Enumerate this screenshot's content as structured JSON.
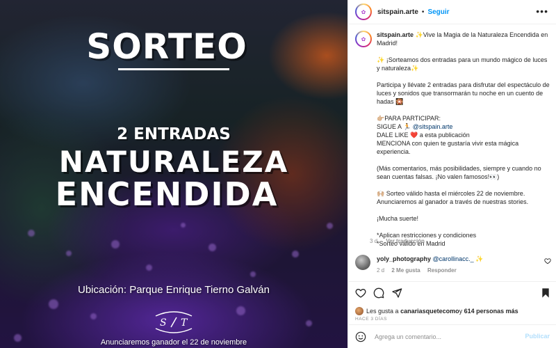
{
  "image": {
    "title": "SORTEO",
    "subtitle": "2 ENTRADAS",
    "headline_line1": "NATURALEZA",
    "headline_line2": "ENCENDIDA",
    "location": "Ubicación: Parque Enrique Tierno Galván",
    "logo_text": "S / T",
    "footer": "Anunciaremos ganador el 22 de noviembre"
  },
  "header": {
    "username": "sitspain.arte",
    "dot": "•",
    "follow_label": "Seguir",
    "more_icon": "more-horizontal-icon"
  },
  "caption": {
    "username": "sitspain.arte",
    "text": "✨Vive la Magia de la Naturaleza Encendida en Madrid!\n\n✨ ¡Sorteamos dos entradas para un mundo mágico de luces y naturaleza✨\n\nParticipa y llévate 2 entradas para disfrutar del espectáculo de luces y sonidos que transormarán tu noche en un cuento de hadas 🎇\n\n👉🏼PARA PARTICIPAR:\nSIGUE A 🏃 ",
    "mention": "@sitspain.arte",
    "text_after": "\nDALE LIKE ❤️ a esta publicación\nMENCIONA con quien te gustaría vivir esta mágica experiencia.\n\n(Más comentarios, más posibilidades, siempre y cuando no sean cuentas falsas. ¡No valen famosos!👀)\n\n🙌🏼 Sorteo válido hasta el miércoles 22 de noviembre. Anunciaremos al ganador a través de nuestras stories.\n\n¡Mucha suerte!\n\n*Aplican restricciones y condiciones\n*Sorteo válido en Madrid",
    "time": "3 d",
    "translate_label": "Ver traducción"
  },
  "comment": {
    "username": "yoly_photography",
    "mention": "@carollinacc._",
    "emoji": "✨",
    "time": "2 d",
    "likes_label": "2 Me gusta",
    "reply_label": "Responder"
  },
  "actions": {
    "likes_prefix": "Les gusta a ",
    "likes_user": "canariasquetecomo",
    "likes_middle": " y ",
    "likes_count": "614 personas más",
    "time_ago": "HACE 3 DÍAS"
  },
  "add_comment": {
    "placeholder": "Agrega un comentario...",
    "submit_label": "Publicar",
    "submit_color": "#b2dffc"
  },
  "colors": {
    "link_blue": "#0095f6",
    "mention_blue": "#00376b",
    "muted": "#8e8e8e",
    "text": "#262626"
  }
}
